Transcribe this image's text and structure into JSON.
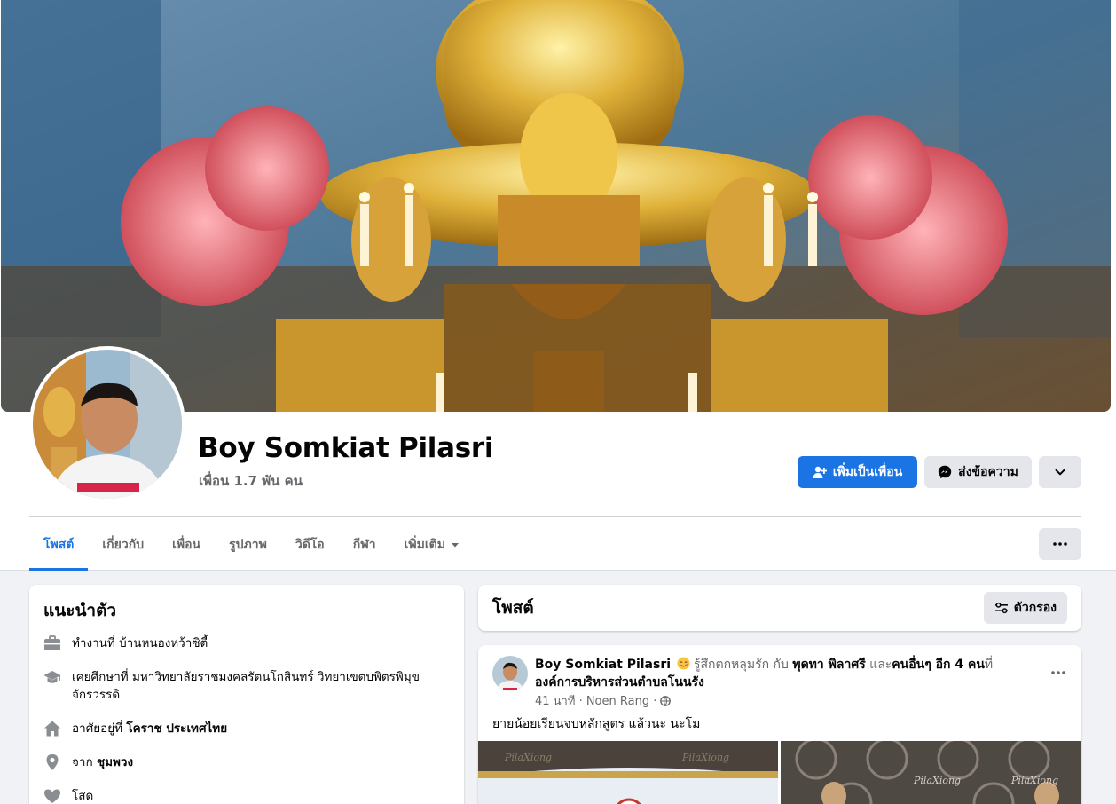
{
  "profile": {
    "name": "Boy Somkiat Pilasri",
    "friends": "เพื่อน 1.7 พัน คน"
  },
  "actions": {
    "add_friend": "เพิ่มเป็นเพื่อน",
    "message": "ส่งข้อความ"
  },
  "tabs": [
    {
      "label": "โพสต์",
      "active": true
    },
    {
      "label": "เกี่ยวกับ"
    },
    {
      "label": "เพื่อน"
    },
    {
      "label": "รูปภาพ"
    },
    {
      "label": "วิดีโอ"
    },
    {
      "label": "กีฬา"
    },
    {
      "label": "เพิ่มเติม"
    }
  ],
  "intro": {
    "title": "แนะนำตัว",
    "work_prefix": "ทำงานที่ ",
    "work_value": "บ้านหนองหว้าซิตี้",
    "study_prefix": "เคยศึกษาที่ ",
    "study_value": "มหาวิทยาลัยราชมงคลรัตนโกสินทร์ วิทยาเขตบพิตรพิมุข จักรวรรดิ",
    "lives_prefix": "อาศัยอยู่ที่ ",
    "lives_value": "โคราช ประเทศไทย",
    "from_prefix": "จาก ",
    "from_value": "ชุมพวง",
    "relationship": "โสด"
  },
  "posts_section": {
    "title": "โพสต์",
    "filter_label": "ตัวกรอง"
  },
  "post": {
    "author": "Boy Somkiat Pilasri",
    "feeling": " รู้สึกตกหลุมรัก กับ ",
    "tagged": "พุดทา พิลาศรี",
    "and": " และ",
    "others": "คนอื่นๆ อีก 4 คน",
    "at": "ที่",
    "place": "องค์การบริหารส่วนตำบลโนนรัง",
    "time": "41 นาที · Noen Rang ·",
    "text": "ยายน้อยเรียนจบหลักสูตร แล้วนะ นะโม",
    "image_text": "PilaXiong"
  },
  "colors": {
    "accent": "#1b74e4",
    "secondary_button": "#e4e6eb",
    "page_bg": "#f0f2f5"
  },
  "icons": {
    "add_friend": "person-plus-icon",
    "message": "messenger-icon",
    "more": "chevron-down-icon",
    "options": "ellipsis-icon",
    "filter": "sliders-icon",
    "work": "briefcase-icon",
    "study": "graduation-cap-icon",
    "home": "house-icon",
    "location": "pin-icon",
    "relationship": "heart-icon",
    "globe": "globe-icon",
    "feeling": "smiling-face-icon"
  }
}
